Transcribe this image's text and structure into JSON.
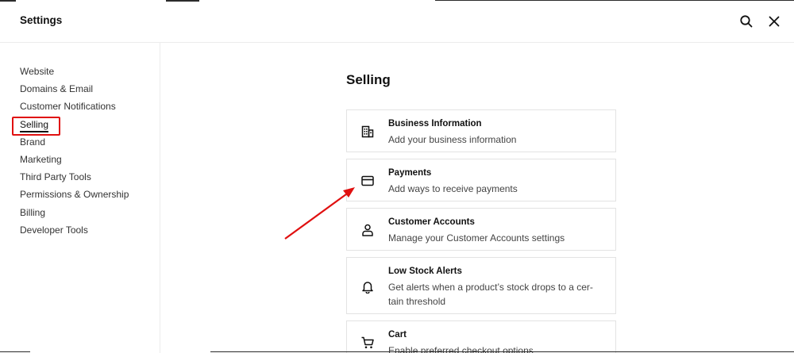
{
  "header": {
    "title": "Settings",
    "search_icon": "search-icon",
    "close_icon": "close-icon"
  },
  "sidebar": {
    "items": [
      {
        "label": "Website"
      },
      {
        "label": "Domains & Email"
      },
      {
        "label": "Customer Notifications"
      },
      {
        "label": "Selling",
        "active": true
      },
      {
        "label": "Brand"
      },
      {
        "label": "Marketing"
      },
      {
        "label": "Third Party Tools"
      },
      {
        "label": "Permissions & Ownership"
      },
      {
        "label": "Billing"
      },
      {
        "label": "Developer Tools"
      }
    ]
  },
  "main": {
    "title": "Selling",
    "cards": [
      {
        "title": "Business Information",
        "description": "Add your business information",
        "icon": "building-icon"
      },
      {
        "title": "Payments",
        "description": "Add ways to receive payments",
        "icon": "credit-card-icon"
      },
      {
        "title": "Customer Accounts",
        "description": "Manage your Customer Accounts settings",
        "icon": "person-icon"
      },
      {
        "title": "Low Stock Alerts",
        "description": "Get alerts when a product’s stock drops to a cer-tain threshold",
        "icon": "bell-icon"
      },
      {
        "title": "Cart",
        "description": "Enable preferred checkout options",
        "icon": "cart-icon"
      }
    ]
  },
  "annotations": {
    "highlight_color": "#e01010"
  }
}
